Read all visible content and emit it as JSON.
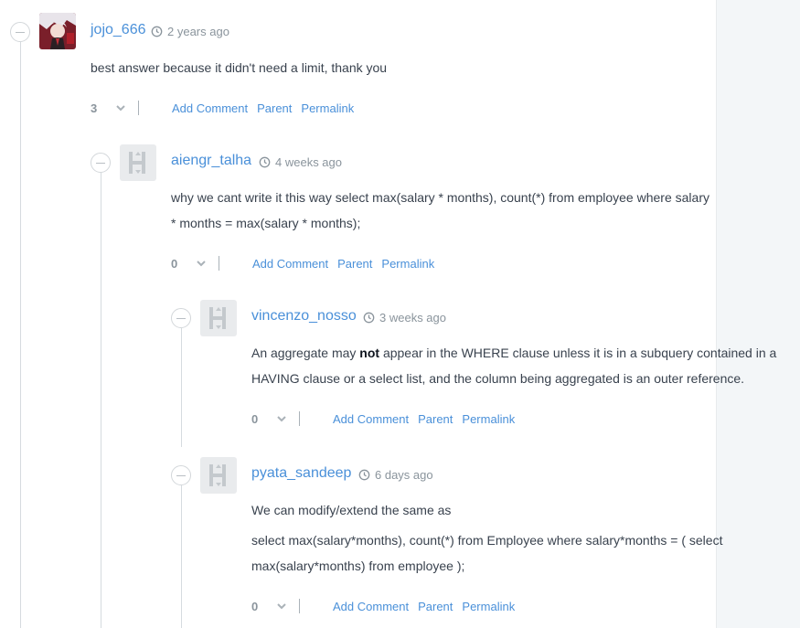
{
  "comments": [
    {
      "username": "jojo_666",
      "time": "2 years ago",
      "body": [
        "best answer because it didn't need a limit, thank you"
      ],
      "votes": "3",
      "actions": {
        "add_comment": "Add Comment",
        "parent": "Parent",
        "permalink": "Permalink"
      }
    },
    {
      "username": "aiengr_talha",
      "time": "4 weeks ago",
      "body": [
        "why we cant write it this way select max(salary * months), count(*) from employee where salary * months = max(salary * months);"
      ],
      "votes": "0",
      "actions": {
        "add_comment": "Add Comment",
        "parent": "Parent",
        "permalink": "Permalink"
      }
    },
    {
      "username": "vincenzo_nosso",
      "time": "3 weeks ago",
      "body_pre": "An aggregate may ",
      "body_bold": "not",
      "body_post": " appear in the WHERE clause unless it is in a subquery contained in a HAVING clause or a select list, and the column being aggregated is an outer reference.",
      "votes": "0",
      "actions": {
        "add_comment": "Add Comment",
        "parent": "Parent",
        "permalink": "Permalink"
      }
    },
    {
      "username": "pyata_sandeep",
      "time": "6 days ago",
      "body": [
        "We can modify/extend the same as",
        "select max(salary*months), count(*) from Employee where salary*months = ( select max(salary*months) from employee );"
      ],
      "votes": "0",
      "actions": {
        "add_comment": "Add Comment",
        "parent": "Parent",
        "permalink": "Permalink"
      }
    }
  ],
  "icons": {
    "collapse": "minus-circle-icon",
    "clock": "clock-icon",
    "downvote": "chevron-down-icon",
    "default_avatar": "hackerrank-h-icon"
  },
  "colors": {
    "link": "#4a90d9",
    "text": "#39424e",
    "muted": "#8a949c",
    "gutter": "#f3f6f8"
  }
}
